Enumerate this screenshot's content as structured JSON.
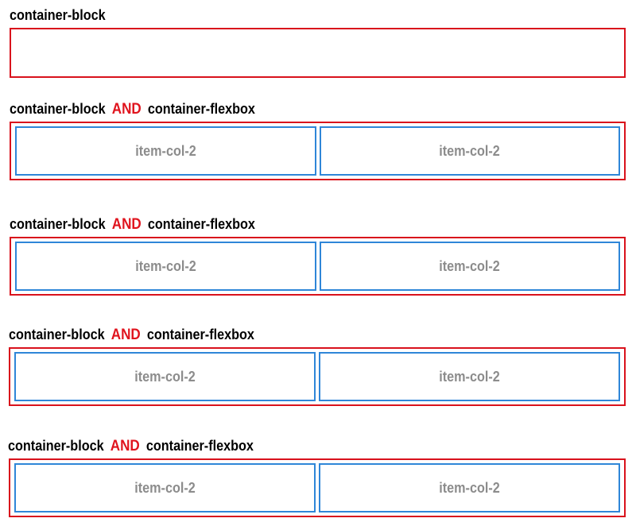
{
  "colors": {
    "container_border": "#d9121c",
    "and_text": "#e0141e",
    "item_border": "#2f86d8",
    "item_text": "#8c8c8c"
  },
  "block_section": {
    "heading": "container-block"
  },
  "flex_sections": [
    {
      "heading_left": "container-block",
      "heading_and": "AND",
      "heading_right": "container-flexbox",
      "items": [
        "item-col-2",
        "item-col-2"
      ]
    },
    {
      "heading_left": "container-block",
      "heading_and": "AND",
      "heading_right": "container-flexbox",
      "items": [
        "item-col-2",
        "item-col-2"
      ]
    },
    {
      "heading_left": "container-block",
      "heading_and": "AND",
      "heading_right": "container-flexbox",
      "items": [
        "item-col-2",
        "item-col-2"
      ]
    },
    {
      "heading_left": "container-block",
      "heading_and": "AND",
      "heading_right": "container-flexbox",
      "items": [
        "item-col-2",
        "item-col-2"
      ]
    }
  ]
}
